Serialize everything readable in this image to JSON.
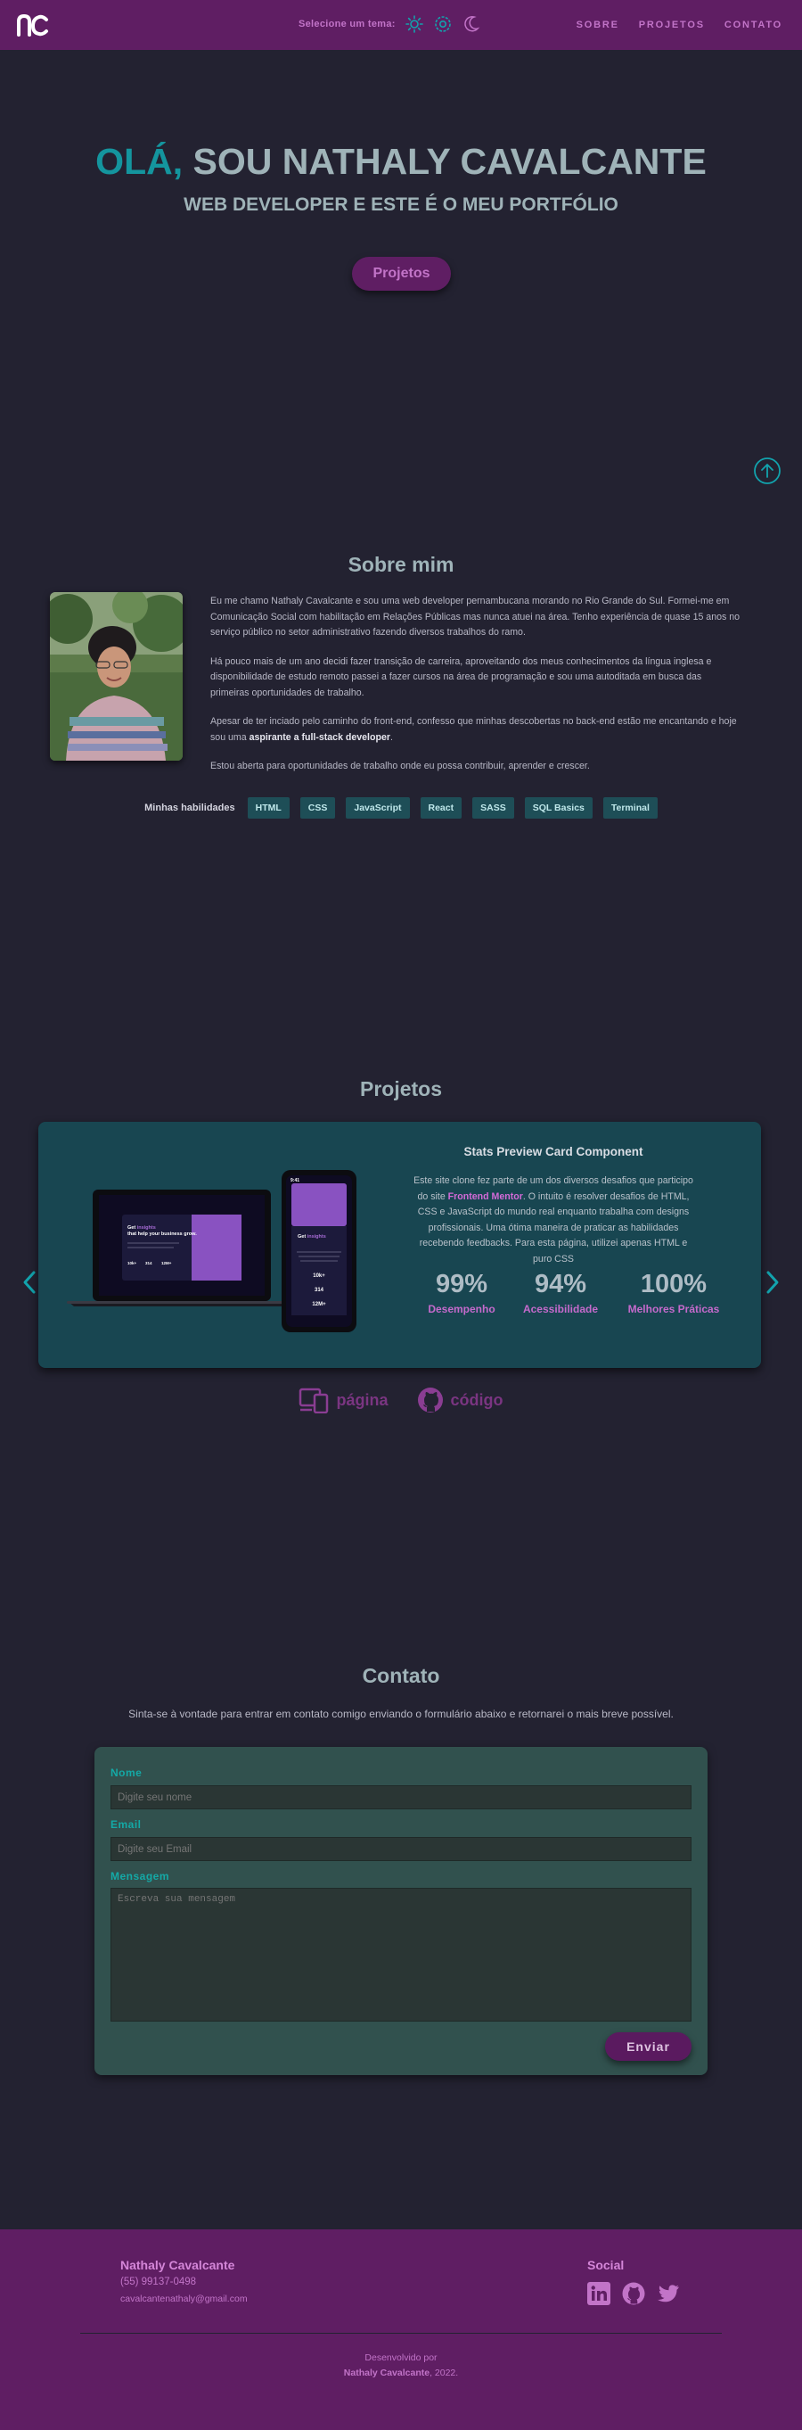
{
  "header": {
    "theme_label": "Selecione um tema:",
    "nav": [
      "SOBRE",
      "PROJETOS",
      "CONTATO"
    ]
  },
  "hero": {
    "greeting": "OLÁ,",
    "name": " SOU NATHALY CAVALCANTE",
    "subtitle": "WEB DEVELOPER E ESTE É O MEU PORTFÓLIO",
    "button": "Projetos"
  },
  "about": {
    "title": "Sobre mim",
    "p1": "Eu me chamo Nathaly Cavalcante e sou uma web developer pernambucana morando no Rio Grande do Sul. Formei-me em Comunicação Social com habilitação em Relações Públicas mas nunca atuei na área. Tenho experiência de quase 15 anos no serviço público no setor administrativo fazendo diversos trabalhos do ramo.",
    "p2": "Há pouco mais de um ano decidi fazer transição de carreira, aproveitando dos meus conhecimentos da língua inglesa e disponibilidade de estudo remoto passei a fazer cursos na área de programação e sou uma autoditada em busca das primeiras oportunidades de trabalho.",
    "p3_a": "Apesar de ter inciado pelo caminho do front-end, confesso que minhas descobertas no back-end estão me encantando e hoje sou uma ",
    "p3_b": "aspirante a full-stack developer",
    "p3_c": ".",
    "p4": "Estou aberta para oportunidades de trabalho onde eu possa contribuir, aprender e crescer.",
    "skills_label": "Minhas habilidades",
    "skills": [
      "HTML",
      "CSS",
      "JavaScript",
      "React",
      "SASS",
      "SQL Basics",
      "Terminal"
    ]
  },
  "projects": {
    "title": "Projetos",
    "card": {
      "name": "Stats Preview Card Component",
      "desc_a": "Este site clone fez parte de um dos diversos desafios que participo do site ",
      "desc_link": "Frontend Mentor",
      "desc_b": ". O intuito é resolver desafios de HTML, CSS e JavaScript do mundo real enquanto trabalha com designs profissionais. Uma ótima maneira de praticar as habilidades recebendo feedbacks. Para esta página, utilizei apenas HTML e puro CSS",
      "metrics": [
        {
          "value": "99%",
          "label": "Desempenho"
        },
        {
          "value": "94%",
          "label": "Acessibilidade"
        },
        {
          "value": "100%",
          "label": "Melhores Práticas"
        }
      ],
      "mock_headline_a": "Get ",
      "mock_headline_b": "insights",
      "mock_headline_c": " that help your business grow.",
      "mock_stats": [
        "10k+",
        "314",
        "12M+"
      ],
      "phone_time": "9:41"
    },
    "links": {
      "page": "página",
      "code": "código"
    }
  },
  "contact": {
    "title": "Contato",
    "intro": "Sinta-se à vontade para entrar em contato comigo enviando o formulário abaixo e retornarei o mais breve possível.",
    "name_label": "Nome",
    "name_placeholder": "Digite seu nome",
    "email_label": "Email",
    "email_placeholder": "Digite seu Email",
    "message_label": "Mensagem",
    "message_placeholder": "Escreva sua mensagem",
    "send": "Enviar"
  },
  "footer": {
    "name": "Nathaly Cavalcante",
    "phone": "(55) 99137-0498",
    "email": "cavalcantenathaly@gmail.com",
    "social_title": "Social",
    "dev_line1": "Desenvolvido por",
    "dev_name": "Nathaly Cavalcante",
    "dev_year": ", 2022."
  },
  "colors": {
    "background": "#232231",
    "header": "#5f1e63",
    "accent_teal": "#14959e",
    "accent_purple": "#c274c8",
    "card": "#184651",
    "form": "#31514e"
  },
  "icons": [
    "logo-nc",
    "sun-icon",
    "gear-icon",
    "moon-icon",
    "arrow-up-circle-icon",
    "chevron-left-icon",
    "chevron-right-icon",
    "devices-icon",
    "github-icon",
    "linkedin-icon",
    "twitter-icon"
  ]
}
